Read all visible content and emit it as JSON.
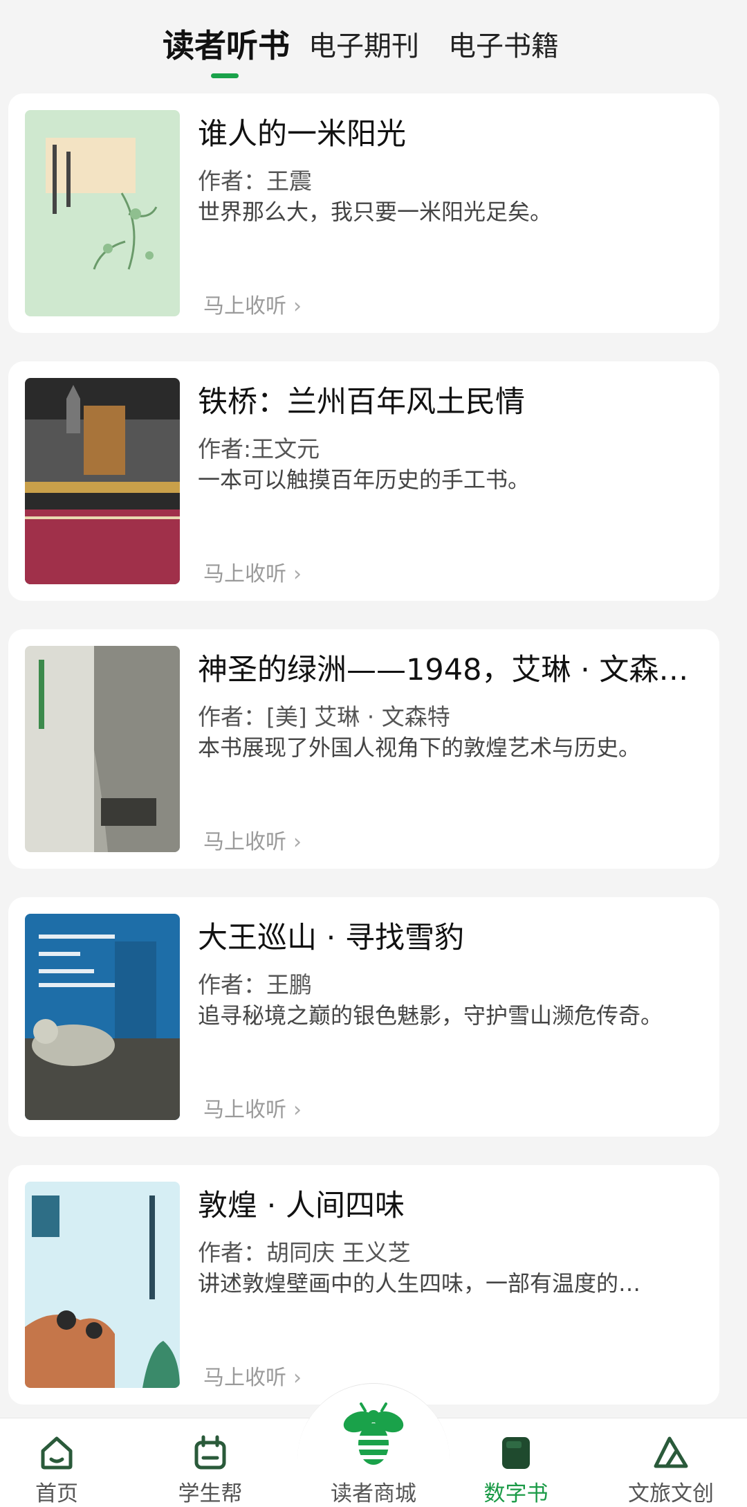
{
  "tabs": [
    {
      "label": "读者听书",
      "active": true
    },
    {
      "label": "电子期刊",
      "active": false
    },
    {
      "label": "电子书籍",
      "active": false
    }
  ],
  "accent_color": "#1aa24a",
  "books": [
    {
      "title": "谁人的一米阳光",
      "author": "作者：王震",
      "desc": "世界那么大，我只要一米阳光足矣。",
      "action": "马上收听",
      "cover_colors": [
        "#cfe8cf",
        "#f3e3c3"
      ]
    },
    {
      "title": "铁桥：兰州百年风土民情",
      "author": "作者:王文元",
      "desc": "一本可以触摸百年历史的手工书。",
      "action": "马上收听",
      "cover_colors": [
        "#2a2a2a",
        "#a0304a"
      ]
    },
    {
      "title": "神圣的绿洲——1948，艾琳 · 文森…",
      "author": "作者：[美] 艾琳 · 文森特",
      "desc": "本书展现了外国人视角下的敦煌艺术与历史。",
      "action": "马上收听",
      "cover_colors": [
        "#dcdcd4",
        "#888880"
      ]
    },
    {
      "title": "大王巡山 · 寻找雪豹",
      "author": "作者：王鹏",
      "desc": "追寻秘境之巅的银色魅影，守护雪山濒危传奇。",
      "action": "马上收听",
      "cover_colors": [
        "#1e6ea8",
        "#4a4a44"
      ]
    },
    {
      "title": "敦煌 · 人间四味",
      "author": "作者：胡同庆 王义芝",
      "desc": "讲述敦煌壁画中的人生四味，一部有温度的…",
      "action": "马上收听",
      "cover_colors": [
        "#d6eef4",
        "#c5764a"
      ]
    }
  ],
  "nav": [
    {
      "label": "首页",
      "icon": "home-icon",
      "active": false
    },
    {
      "label": "学生帮",
      "icon": "calendar-bag-icon",
      "active": false
    },
    {
      "label": "读者商城",
      "icon": "bee-logo-icon",
      "active": false
    },
    {
      "label": "数字书",
      "icon": "book-icon",
      "active": true
    },
    {
      "label": "文旅文创",
      "icon": "mountain-icon",
      "active": false
    }
  ]
}
